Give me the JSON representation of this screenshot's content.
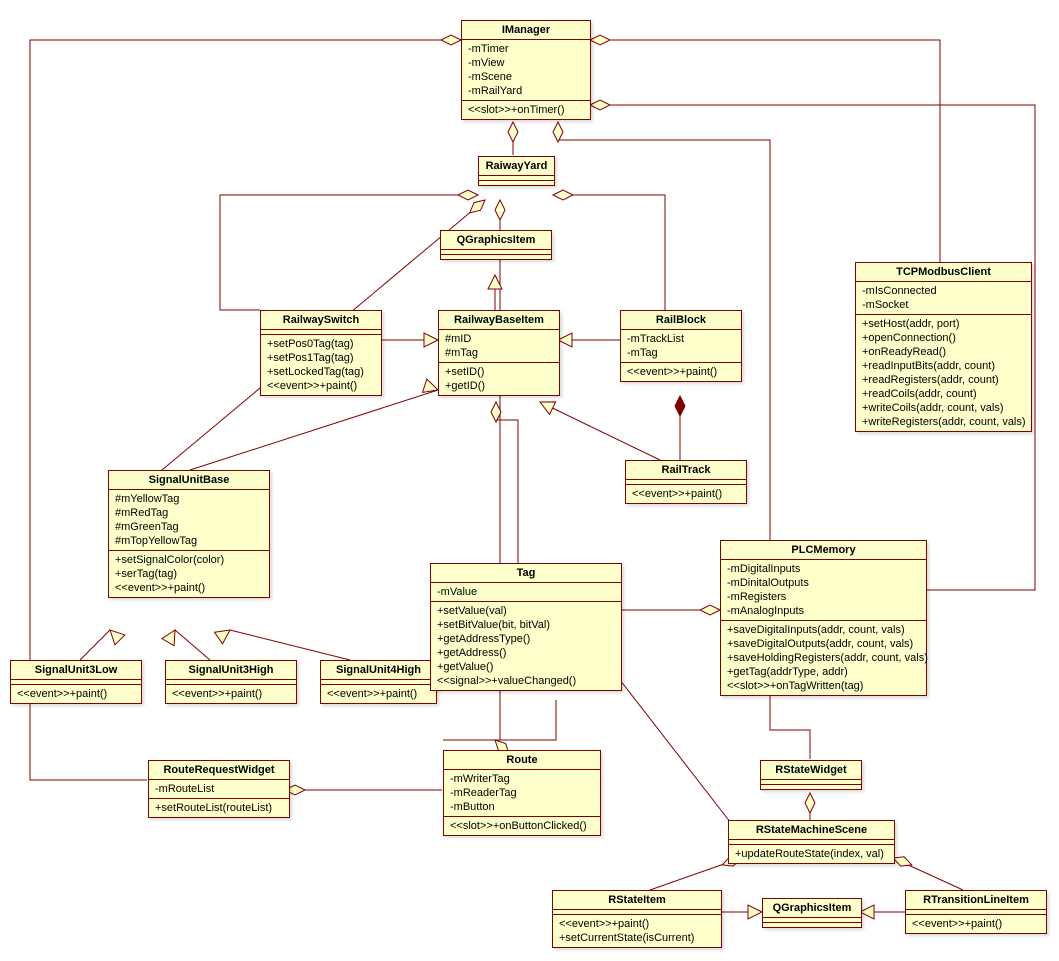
{
  "classes": {
    "IManager": {
      "title": "IManager",
      "attrs": [
        "-mTimer",
        "-mView",
        "-mScene",
        "-mRailYard"
      ],
      "ops": [
        "<<slot>>+onTimer()"
      ]
    },
    "RaiwayYard": {
      "title": "RaiwayYard",
      "attrs": [],
      "ops": []
    },
    "QGraphicsItem": {
      "title": "QGraphicsItem",
      "attrs": [],
      "ops": []
    },
    "RailwaySwitch": {
      "title": "RailwaySwitch",
      "attrs": [],
      "ops": [
        "+setPos0Tag(tag)",
        "+setPos1Tag(tag)",
        "+setLockedTag(tag)",
        "<<event>>+paint()"
      ]
    },
    "RailwayBaseItem": {
      "title": "RailwayBaseItem",
      "attrs": [
        "#mID",
        "#mTag"
      ],
      "ops": [
        "+setID()",
        "+getID()"
      ]
    },
    "RailBlock": {
      "title": "RailBlock",
      "attrs": [
        "-mTrackList",
        "-mTag"
      ],
      "ops": [
        "<<event>>+paint()"
      ]
    },
    "TCPModbusClient": {
      "title": "TCPModbusClient",
      "attrs": [
        "-mIsConnected",
        "-mSocket"
      ],
      "ops": [
        "+setHost(addr, port)",
        "+openConnection()",
        "+onReadyRead()",
        "+readInputBits(addr, count)",
        "+readRegisters(addr, count)",
        "+readCoils(addr, count)",
        "+writeCoils(addr, count, vals)",
        "+writeRegisters(addr, count, vals)"
      ]
    },
    "RailTrack": {
      "title": "RailTrack",
      "attrs": [],
      "ops": [
        "<<event>>+paint()"
      ]
    },
    "SignalUnitBase": {
      "title": "SignalUnitBase",
      "attrs": [
        "#mYellowTag",
        "#mRedTag",
        "#mGreenTag",
        "#mTopYellowTag"
      ],
      "ops": [
        "+setSignalColor(color)",
        "+serTag(tag)",
        "<<event>>+paint()"
      ]
    },
    "SignalUnit3Low": {
      "title": "SignalUnit3Low",
      "attrs": [],
      "ops": [
        "<<event>>+paint()"
      ]
    },
    "SignalUnit3High": {
      "title": "SignalUnit3High",
      "attrs": [],
      "ops": [
        "<<event>>+paint()"
      ]
    },
    "SignalUnit4High": {
      "title": "SignalUnit4High",
      "attrs": [],
      "ops": [
        "<<event>>+paint()"
      ]
    },
    "Tag": {
      "title": "Tag",
      "attrs": [
        "-mValue"
      ],
      "ops": [
        "+setValue(val)",
        "+setBitValue(bit, bitVal)",
        "+getAddressType()",
        "+getAddress()",
        "+getValue()",
        "<<signal>>+valueChanged()"
      ]
    },
    "PLCMemory": {
      "title": "PLCMemory",
      "attrs": [
        "-mDigitalInputs",
        "-mDinitalOutputs",
        "-mRegisters",
        "-mAnalogInputs"
      ],
      "ops": [
        "+saveDigitalInputs(addr, count, vals)",
        "+saveDigitalOutputs(addr, count, vals)",
        "+saveHoldingRegisters(addr, count, vals)",
        "+getTag(addrType, addr)",
        "<<slot>>+onTagWritten(tag)"
      ]
    },
    "RouteRequestWidget": {
      "title": "RouteRequestWidget",
      "attrs": [
        "-mRouteList"
      ],
      "ops": [
        "+setRouteList(routeList)"
      ]
    },
    "Route": {
      "title": "Route",
      "attrs": [
        "-mWriterTag",
        "-mReaderTag",
        "-mButton"
      ],
      "ops": [
        "<<slot>>+onButtonClicked()"
      ]
    },
    "RStateWidget": {
      "title": "RStateWidget",
      "attrs": [],
      "ops": []
    },
    "RStateMachineScene": {
      "title": "RStateMachineScene",
      "attrs": [],
      "ops": [
        "+updateRouteState(index, val)"
      ]
    },
    "RStateItem": {
      "title": "RStateItem",
      "attrs": [],
      "ops": [
        "<<event>>+paint()",
        "+setCurrentState(isCurrent)"
      ]
    },
    "QGraphicsItem2": {
      "title": "QGraphicsItem",
      "attrs": [],
      "ops": []
    },
    "RTransitionLineItem": {
      "title": "RTransitionLineItem",
      "attrs": [],
      "ops": [
        "<<event>>+paint()"
      ]
    }
  }
}
